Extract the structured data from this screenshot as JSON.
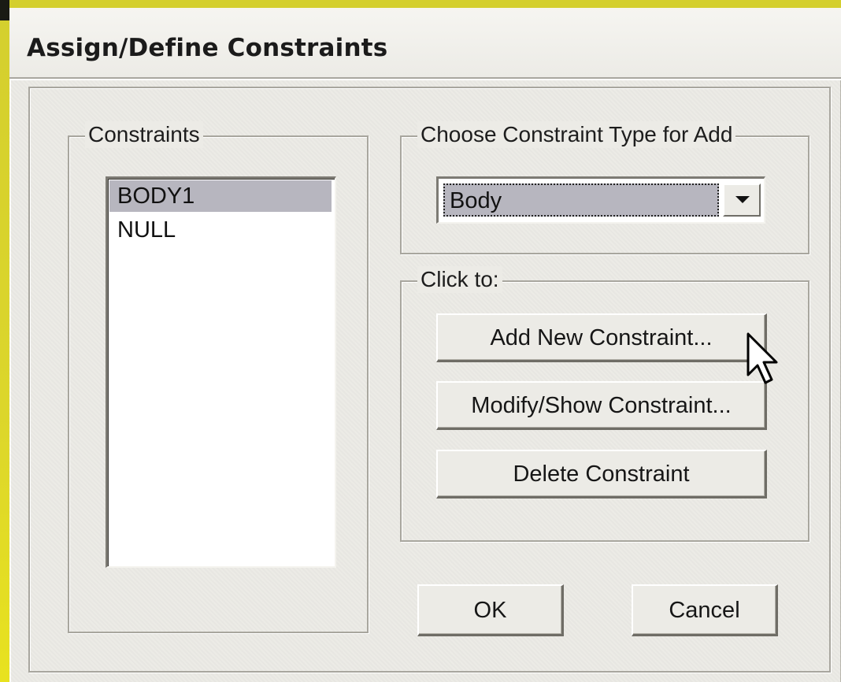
{
  "window": {
    "title": "Assign/Define Constraints"
  },
  "constraints_group": {
    "label": "Constraints",
    "items": [
      {
        "label": "BODY1",
        "selected": true
      },
      {
        "label": "NULL",
        "selected": false
      }
    ]
  },
  "type_group": {
    "label": "Choose Constraint Type for Add",
    "selected_value": "Body"
  },
  "actions_group": {
    "label": "Click to:",
    "add_label": "Add New Constraint...",
    "modify_label": "Modify/Show Constraint...",
    "delete_label": "Delete Constraint"
  },
  "footer": {
    "ok_label": "OK",
    "cancel_label": "Cancel"
  },
  "colors": {
    "desktop_border": "#dcd62b",
    "dialog_face": "#ecebe6",
    "selection": "#b7b6bf"
  },
  "icons": {
    "dropdown": "chevron-down-icon",
    "pointer": "mouse-pointer-icon"
  }
}
